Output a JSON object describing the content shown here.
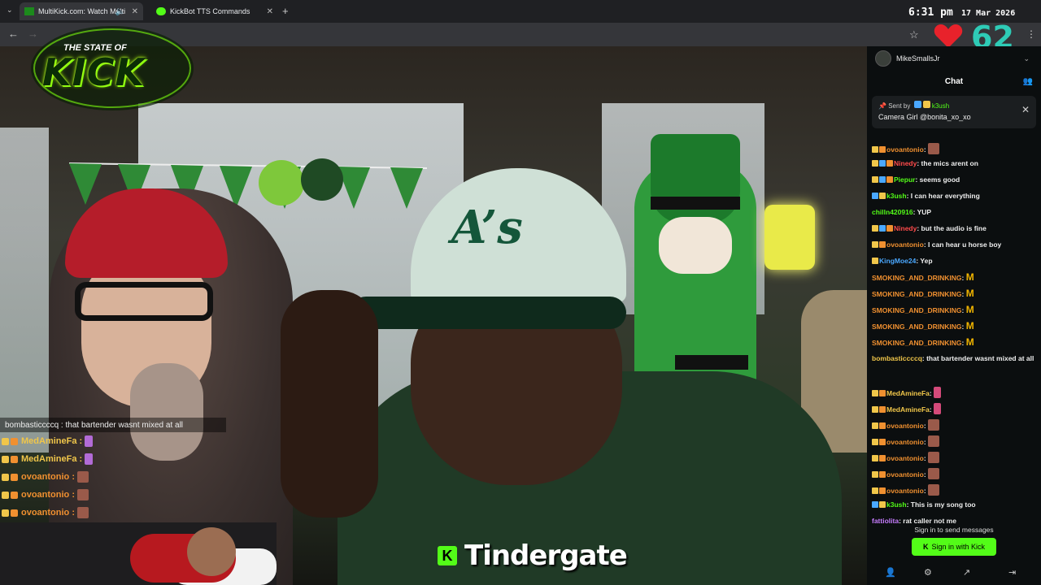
{
  "browser": {
    "tabs": [
      {
        "label": "MultiKick.com: Watch Multi",
        "active": true
      },
      {
        "label": "KickBot TTS Commands",
        "active": false
      }
    ]
  },
  "overlay": {
    "clock": "6:31 pm",
    "date": "17 Mar 2026",
    "viewer_count": "62",
    "logo_top": "THE STATE OF",
    "logo_main": "KICK",
    "banner_k": "K",
    "banner_text": "Tindergate",
    "chat": [
      {
        "user": "bombasticcccq",
        "text": "that bartender wasnt mixed at all",
        "color": "#eeeeee"
      },
      {
        "user": "MedAmineFa",
        "text": "",
        "color": "#f0c64a"
      },
      {
        "user": "MedAmineFa",
        "text": "",
        "color": "#f0c64a"
      },
      {
        "user": "ovoantonio",
        "text": "",
        "color": "#f09030"
      },
      {
        "user": "ovoantonio",
        "text": "",
        "color": "#f09030"
      },
      {
        "user": "ovoantonio",
        "text": "",
        "color": "#f09030"
      }
    ]
  },
  "chat_panel": {
    "channel": "MikeSmallsJr",
    "title": "Chat",
    "pinned_sent_by": "Sent by",
    "pinned_user": "k3ush",
    "pinned_message": "Camera Girl @bonita_xo_xo",
    "messages": [
      {
        "user": "ovoantonio",
        "text": "",
        "color": "#f09030"
      },
      {
        "user": "Ninedy",
        "text": "the mics arent on",
        "color": "#ff4b4b"
      },
      {
        "user": "Piepur",
        "text": "seems good",
        "color": "#53fc18"
      },
      {
        "user": "k3ush",
        "text": "I can hear everything",
        "color": "#53fc18"
      },
      {
        "user": "chilln420916",
        "text": "YUP",
        "color": "#53fc18"
      },
      {
        "user": "Ninedy",
        "text": "but the audio is fine",
        "color": "#ff4b4b"
      },
      {
        "user": "ovoantonio",
        "text": "I can hear u horse boy",
        "color": "#f09030"
      },
      {
        "user": "KingMoe24",
        "text": "Yep",
        "color": "#4aa8ff"
      },
      {
        "user": "SMOKING_AND_DRINKING",
        "text": "",
        "color": "#f09030"
      },
      {
        "user": "SMOKING_AND_DRINKING",
        "text": "",
        "color": "#f09030"
      },
      {
        "user": "SMOKING_AND_DRINKING",
        "text": "",
        "color": "#f09030"
      },
      {
        "user": "SMOKING_AND_DRINKING",
        "text": "",
        "color": "#f09030"
      },
      {
        "user": "SMOKING_AND_DRINKING",
        "text": "",
        "color": "#f09030"
      },
      {
        "user": "bombasticcccq",
        "text": "that bartender wasnt mixed at all",
        "color": "#f0c64a"
      },
      {
        "user": "MedAmineFa",
        "text": "",
        "color": "#f0c64a"
      },
      {
        "user": "MedAmineFa",
        "text": "",
        "color": "#f0c64a"
      },
      {
        "user": "ovoantonio",
        "text": "",
        "color": "#f09030"
      },
      {
        "user": "ovoantonio",
        "text": "",
        "color": "#f09030"
      },
      {
        "user": "ovoantonio",
        "text": "",
        "color": "#f09030"
      },
      {
        "user": "ovoantonio",
        "text": "",
        "color": "#f09030"
      },
      {
        "user": "ovoantonio",
        "text": "",
        "color": "#f09030"
      },
      {
        "user": "k3ush",
        "text": "This is my song too",
        "color": "#53fc18"
      },
      {
        "user": "fattiolita",
        "text": "rat caller not me",
        "color": "#c77dff"
      }
    ],
    "signin_prompt": "Sign in to send messages",
    "signin_button": "Sign in with Kick",
    "accent": "#53fc18"
  }
}
